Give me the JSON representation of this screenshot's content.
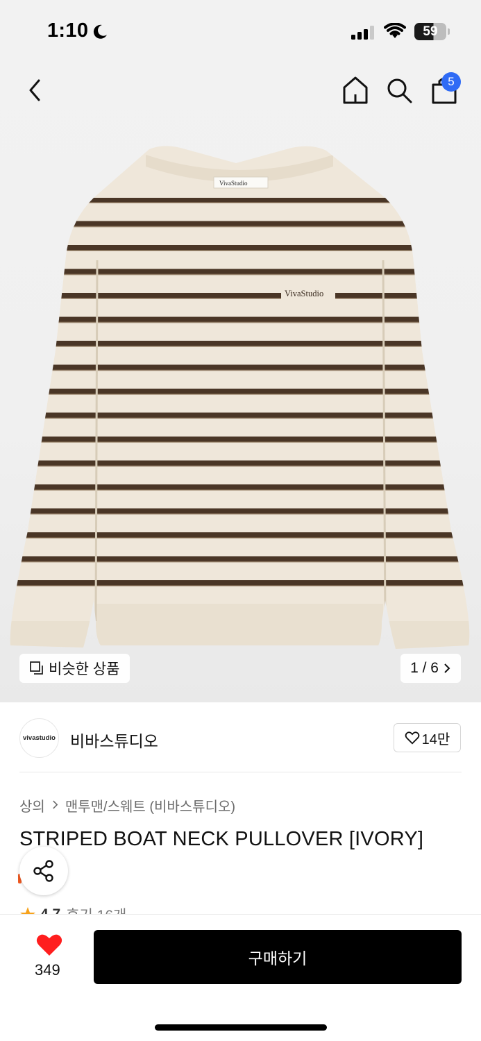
{
  "status_bar": {
    "time": "1:10",
    "battery_level": "59"
  },
  "nav": {
    "cart_count": "5"
  },
  "image": {
    "similar_label": "비슷한 상품",
    "page_counter": "1 / 6",
    "label_brand": "VivaStudio",
    "embroidery_text": "VivaStudio"
  },
  "brand": {
    "logo_text": "vivastudio",
    "name": "비바스튜디오",
    "like_count": "14만"
  },
  "breadcrumb": {
    "category": "상의",
    "subcategory": "맨투맨/스웨트 (비바스튜디오)"
  },
  "product": {
    "title": "STRIPED BOAT NECK PULLOVER [IVORY]",
    "rating": "4.7",
    "reviews": "후기 16개"
  },
  "bottom": {
    "like_count": "349",
    "buy_label": "구매하기"
  },
  "colors": {
    "badge": "#2f6bf5",
    "heart": "#ff1e1e",
    "star": "#f7a21b",
    "sweater_base": "#ece4d6",
    "stripe": "#4a3626"
  }
}
